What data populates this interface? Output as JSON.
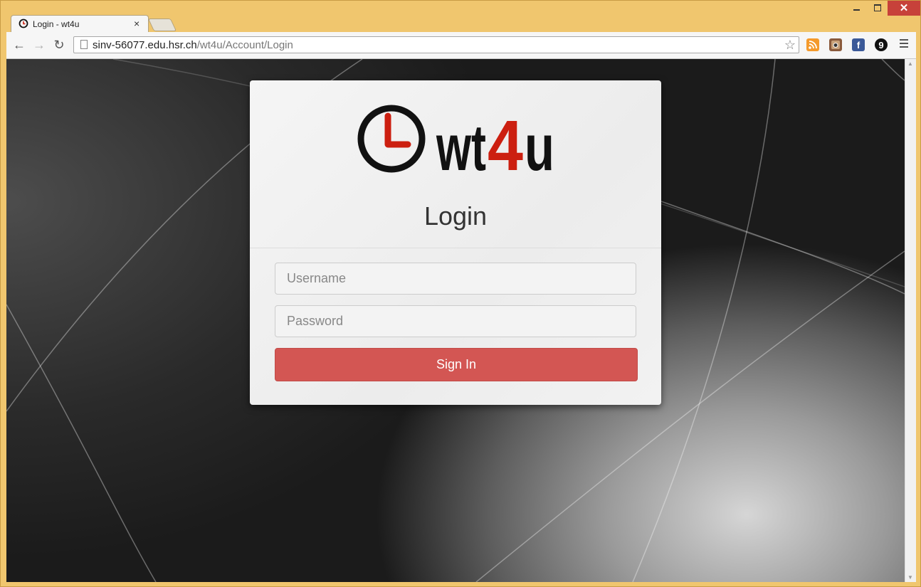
{
  "window": {
    "close_glyph": "✕"
  },
  "tab": {
    "title": "Login - wt4u",
    "close_glyph": "×"
  },
  "toolbar": {
    "back_glyph": "←",
    "forward_glyph": "→",
    "reload_glyph": "↻",
    "url_host": "sinv-56077.edu.hsr.ch",
    "url_path": "/wt4u/Account/Login",
    "star_glyph": "☆",
    "extensions": [
      {
        "name": "rss-icon",
        "glyph": ""
      },
      {
        "name": "instagram-icon",
        "glyph": ""
      },
      {
        "name": "facebook-icon",
        "glyph": "f"
      },
      {
        "name": "nine-icon",
        "glyph": "9"
      }
    ]
  },
  "scrollbar": {
    "up_glyph": "▲",
    "down_glyph": "▼"
  },
  "login": {
    "logo_text_left": "wt",
    "logo_text_accent": "4",
    "logo_text_right": "u",
    "title": "Login",
    "username_placeholder": "Username",
    "password_placeholder": "Password",
    "signin_label": "Sign In"
  },
  "colors": {
    "accent": "#d35653",
    "logo_red": "#cc1f10",
    "window_frame": "#f0c66e"
  }
}
